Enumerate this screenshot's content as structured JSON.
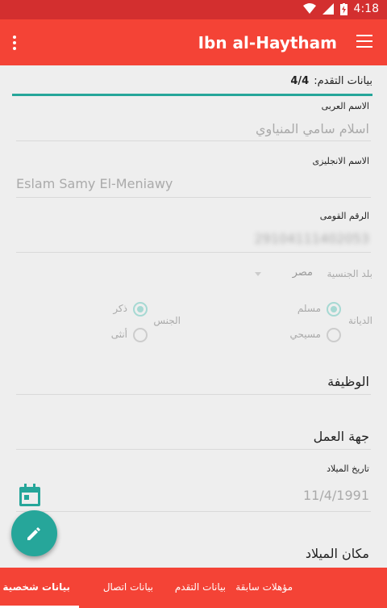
{
  "status": {
    "time": "4:18"
  },
  "appbar": {
    "title": "Ibn al-Haytham"
  },
  "progress": {
    "label": "بيانات التقدم:",
    "value": "4/4"
  },
  "fields": {
    "arabic_name_label": "الاسم العربى",
    "arabic_name_value": "اسلام سامي المنياوي",
    "english_name_label": "الاسم الانجليزى",
    "english_name_value": "Eslam Samy El-Meniawy",
    "national_id_label": "الرقم القومى",
    "national_id_value": "29104111402053",
    "nationality_label": "بلد الجنسية",
    "nationality_value": "مصر",
    "religion_label": "الديانة",
    "religion_options": [
      "مسلم",
      "مسيحي"
    ],
    "gender_label": "الجنس",
    "gender_options": [
      "ذكر",
      "أنثى"
    ],
    "job_placeholder": "الوظيفة",
    "employer_placeholder": "جهة العمل",
    "birthdate_label": "تاريخ الميلاد",
    "birthdate_value": "11/4/1991",
    "birthplace_placeholder": "مكان الميلاد"
  },
  "tabs": [
    {
      "label": "بيانات شخصية",
      "active": true
    },
    {
      "label": "بيانات اتصال",
      "active": false
    },
    {
      "label": "بيانات التقدم",
      "active": false
    },
    {
      "label": "مؤهلات سابقة",
      "active": false
    }
  ],
  "colors": {
    "primary": "#f44336",
    "primary_dark": "#d32f2f",
    "accent": "#26a69a"
  }
}
